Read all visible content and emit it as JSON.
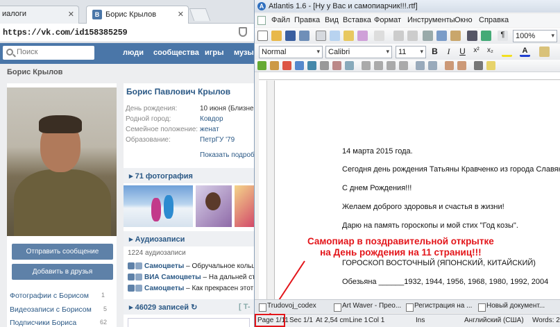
{
  "browser": {
    "tab_left": "иалоги",
    "tab_active": "Борис Крылов",
    "url": "https://vk.com/id158385259",
    "search_placeholder": "Поиск",
    "nav": [
      "люди",
      "сообщества",
      "игры",
      "музы"
    ],
    "profile_header": "Борис Крылов",
    "buttons": {
      "send_message": "Отправить сообщение",
      "add_friend": "Добавить в друзья"
    },
    "left_links": [
      {
        "label": "Фотографии с Борисом",
        "count": "1"
      },
      {
        "label": "Видеозаписи с Борисом",
        "count": "5"
      },
      {
        "label": "Подписчики Бориса",
        "count": "62"
      }
    ],
    "profile": {
      "full_name": "Борис Павлович Крылов",
      "rows": [
        {
          "label": "День рождения:",
          "value": "10 июня (Близне"
        },
        {
          "label": "Родной город:",
          "value": "Ковдор"
        },
        {
          "label": "Семейное положение:",
          "value": "женат"
        },
        {
          "label": "Образование:",
          "value": "ПетрГУ '79"
        }
      ],
      "more": "Показать подроб",
      "photos_header": "71 фотография",
      "audio_header": "Аудиозаписи",
      "audio_count": "1224 аудиозаписи",
      "audio": [
        {
          "artist": "Самоцветы",
          "title": "Обручальное кольц"
        },
        {
          "artist": "ВИА Самоцветы",
          "title": "На дальней ст"
        },
        {
          "artist": "Самоцветы",
          "title": "Как прекрасен этот"
        }
      ],
      "wall_header": "46029 записей",
      "wall_tag": "[ T-"
    }
  },
  "editor": {
    "title": "Atlantis 1.6 - [Ну у Вас и самопиарчик!!!.rtf]",
    "menu": [
      "Файл",
      "Правка",
      "Вид",
      "Вставка",
      "Формат",
      "Инструменты",
      "Окно",
      "Справка"
    ],
    "style": "Normal",
    "font": "Calibri",
    "size": "11",
    "zoom": "100%",
    "doc_lines": [
      "14 марта 2015 года.",
      "Сегодня день рождения Татьяны Кравченко из города Славянск",
      "С днем Рождения!!!",
      "Желаем доброго здоровья и счастья в жизни!",
      "Дарю на память гороскопы и мой стих \"Год козы\".",
      "ГОРОСКОП ВОСТОЧНЫЙ (ЯПОНСКИЙ, КИТАЙСКИЙ)",
      "Обезьяна ______1932, 1944, 1956, 1968, 1980, 1992, 2004"
    ],
    "annotation": [
      "Самопиар в поздравительной открытке",
      "на День рождения на 11 страниц!!!"
    ],
    "tasks": [
      "Trudovoj_codex",
      "Art Waver - Прео...",
      "Регистрация на ...",
      "Новый документ..."
    ],
    "status": {
      "page": "Page 1/11",
      "sec": "Sec 1/1",
      "at": "At 2,54 cm",
      "line": "Line 1",
      "col": "Col 1",
      "mode": "Ins",
      "lang": "Английский (США)",
      "words": "Words: 2"
    },
    "colors": {
      "annotation": "#e3151a",
      "vk_blue": "#4a76a8"
    }
  }
}
